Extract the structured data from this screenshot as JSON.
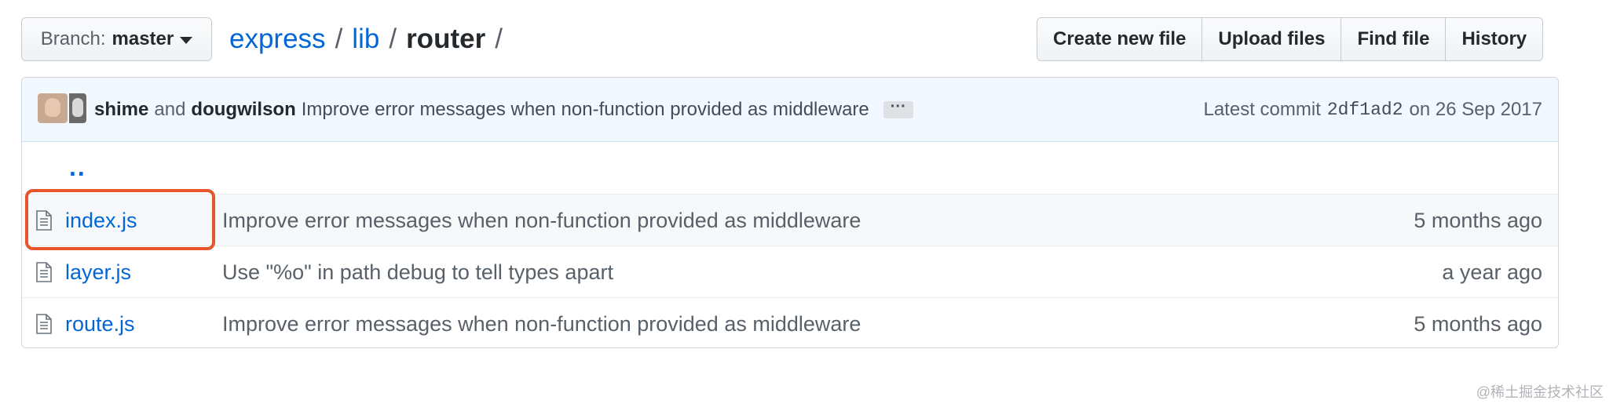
{
  "branch": {
    "label": "Branch:",
    "value": "master"
  },
  "breadcrumb": {
    "repo": "express",
    "sep1": "/",
    "dir": "lib",
    "sep2": "/",
    "current": "router",
    "sep3": "/"
  },
  "actions": {
    "create": "Create new file",
    "upload": "Upload files",
    "find": "Find file",
    "history": "History"
  },
  "commit": {
    "author1": "shime",
    "and": "and",
    "author2": "dougwilson",
    "message": "Improve error messages when non-function provided as middleware",
    "ellipsis": "···",
    "latest_label": "Latest commit",
    "sha": "2df1ad2",
    "date": "on 26 Sep 2017"
  },
  "parent_link": "..",
  "files": [
    {
      "name": "index.js",
      "message": "Improve error messages when non-function provided as middleware",
      "age": "5 months ago"
    },
    {
      "name": "layer.js",
      "message": "Use \"%o\" in path debug to tell types apart",
      "age": "a year ago"
    },
    {
      "name": "route.js",
      "message": "Improve error messages when non-function provided as middleware",
      "age": "5 months ago"
    }
  ],
  "watermark": "@稀土掘金技术社区",
  "colors": {
    "link": "#0366d6",
    "highlight": "#e8542b",
    "commit_bg": "#f1f8ff"
  }
}
